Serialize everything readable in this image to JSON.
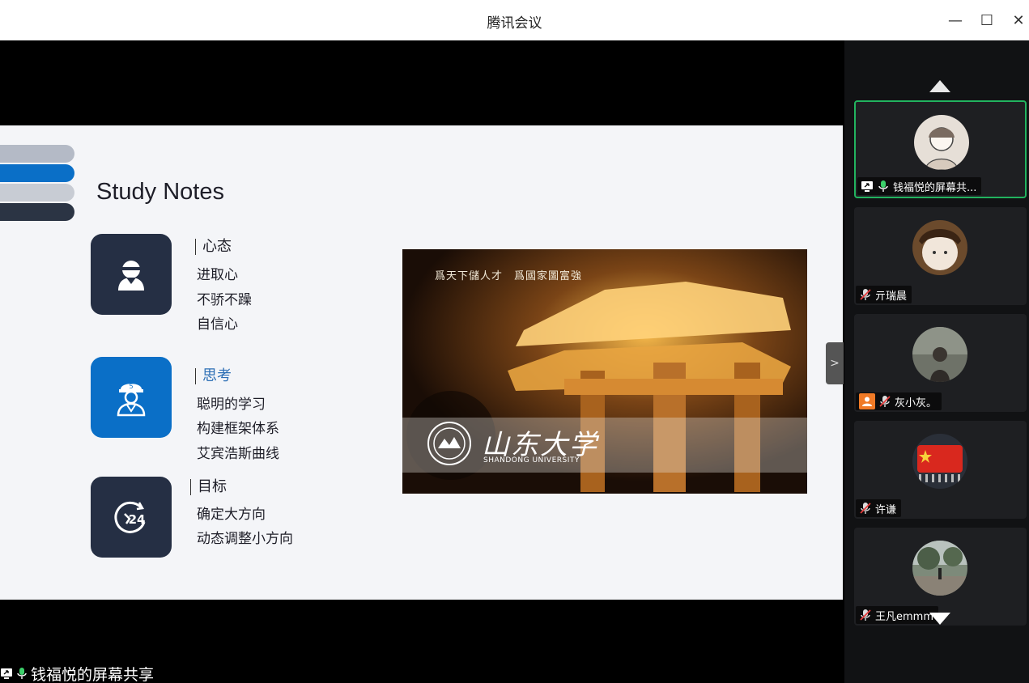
{
  "window": {
    "title": "腾讯会议",
    "controls": {
      "minimize": "—",
      "maximize": "☐",
      "close": "✕"
    }
  },
  "slide": {
    "title": "Study Notes",
    "sections": [
      {
        "heading": "心态",
        "items": [
          "进取心",
          "不骄不躁",
          "自信心"
        ],
        "icon": "user-headset-icon",
        "color": "#252f44"
      },
      {
        "heading": "思考",
        "items": [
          "聪明的学习",
          "构建框架体系",
          "艾宾浩斯曲线"
        ],
        "icon": "worker-icon",
        "color": "#0a6fc7"
      },
      {
        "heading": "目标",
        "items": [
          "确定大方向",
          "动态调整小方向"
        ],
        "icon": "clock-24-icon",
        "color": "#252f44"
      }
    ],
    "photo": {
      "motto": "爲天下儲人才　爲國家圖富強",
      "university_cn": "山东大学",
      "university_en": "SHANDONG UNIVERSITY"
    }
  },
  "share_caption": "钱福悦的屏幕共享",
  "participants": [
    {
      "name": "钱福悦的屏幕共...",
      "mic": "on",
      "screen_share": true,
      "active": true
    },
    {
      "name": "亓瑞晨",
      "mic": "muted"
    },
    {
      "name": "灰小灰。",
      "mic": "muted",
      "host": true
    },
    {
      "name": "许谦",
      "mic": "muted"
    },
    {
      "name": "王凡emmm",
      "mic": "muted"
    }
  ],
  "colors": {
    "accent_blue": "#0a6fc7",
    "dark_navy": "#252f44",
    "active_border": "#22b35f",
    "host_orange": "#f07a26"
  }
}
